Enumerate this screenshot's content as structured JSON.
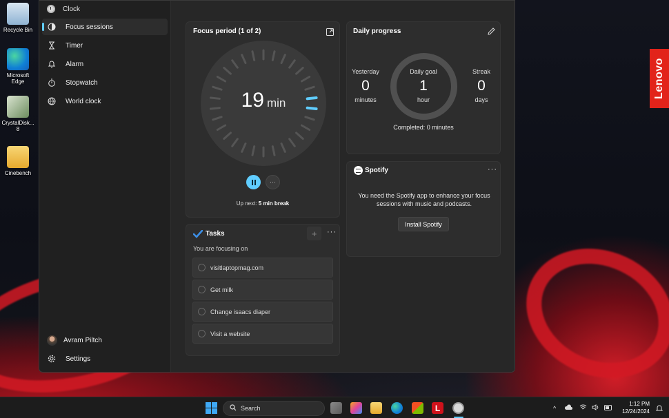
{
  "desktop": {
    "icons": [
      {
        "label": "Recycle Bin",
        "icon": "recycle-bin-icon"
      },
      {
        "label": "Microsoft Edge",
        "icon": "edge-icon"
      },
      {
        "label": "CrystalDisk... 8",
        "icon": "crystaldisk-icon"
      },
      {
        "label": "Cinebench",
        "icon": "folder-icon"
      }
    ],
    "brand_badge": "Lenovo",
    "brand_color": "#e2231a"
  },
  "window": {
    "title": "Clock",
    "controls": {
      "minimize": "—",
      "maximize": "☐",
      "close": "✕"
    }
  },
  "nav": {
    "items": [
      {
        "label": "Focus sessions",
        "icon": "focus-icon",
        "active": true
      },
      {
        "label": "Timer",
        "icon": "hourglass-icon",
        "active": false
      },
      {
        "label": "Alarm",
        "icon": "bell-icon",
        "active": false
      },
      {
        "label": "Stopwatch",
        "icon": "stopwatch-icon",
        "active": false
      },
      {
        "label": "World clock",
        "icon": "globe-icon",
        "active": false
      }
    ],
    "user_name": "Avram Piltch",
    "settings_label": "Settings",
    "accent_color": "#60cdff"
  },
  "focus": {
    "title": "Focus period (1 of 2)",
    "minutes": "19",
    "unit": "min",
    "up_next_prefix": "Up next:",
    "up_next_value": "5 min break",
    "more_label": "···"
  },
  "tasks": {
    "title": "Tasks",
    "add_label": "+",
    "more_label": "···",
    "subtitle": "You are focusing on",
    "items": [
      "visitlaptopmag.com",
      "Get milk",
      "Change isaacs diaper",
      "Visit a website"
    ]
  },
  "daily": {
    "title": "Daily progress",
    "yesterday": {
      "label": "Yesterday",
      "value": "0",
      "unit": "minutes"
    },
    "goal": {
      "label": "Daily goal",
      "value": "1",
      "unit": "hour"
    },
    "streak": {
      "label": "Streak",
      "value": "0",
      "unit": "days"
    },
    "completed": "Completed: 0 minutes"
  },
  "spotify": {
    "brand": "Spotify",
    "more_label": "···",
    "message": "You need the Spotify app to enhance your focus sessions with music and podcasts.",
    "install_label": "Install Spotify"
  },
  "taskbar": {
    "search_placeholder": "Search",
    "time": "1:12 PM",
    "date": "12/24/2024",
    "tray_caret": "^"
  }
}
